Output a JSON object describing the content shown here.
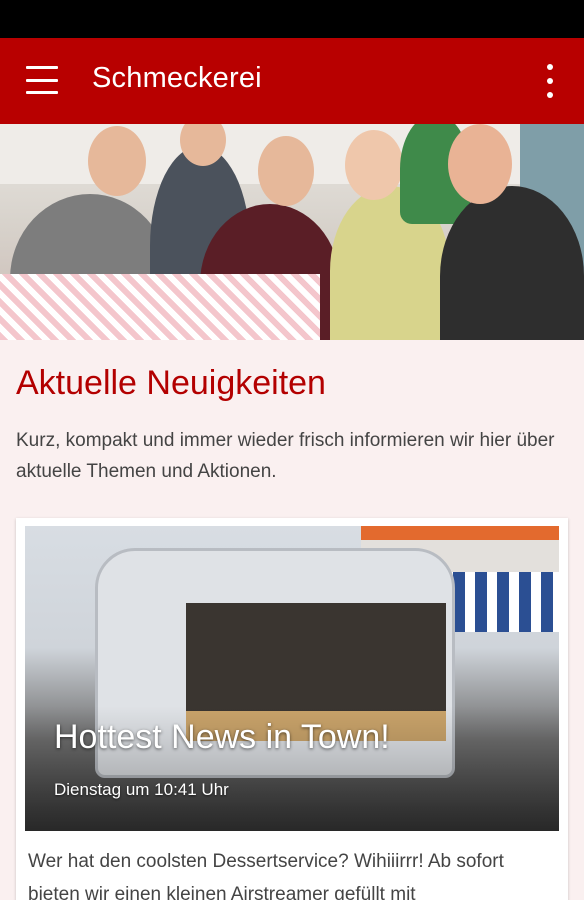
{
  "app": {
    "title": "Schmeckerei",
    "menu_icon": "hamburger-menu-icon",
    "overflow_icon": "more-vert-icon",
    "accent_color": "#b80000"
  },
  "hero": {
    "image_desc": "group-photo"
  },
  "section": {
    "title": "Aktuelle Neuigkeiten",
    "intro": "Kurz, kompakt und immer wieder frisch informieren wir hier über aktuelle Themen und Aktionen."
  },
  "news": {
    "headline": "Hottest News in Town!",
    "date": "Dienstag um 10:41 Uhr",
    "excerpt": "Wer hat den coolsten Dessertservice? Wihiiirrr! Ab sofort bieten wir einen kleinen Airstreamer gefüllt mit"
  }
}
